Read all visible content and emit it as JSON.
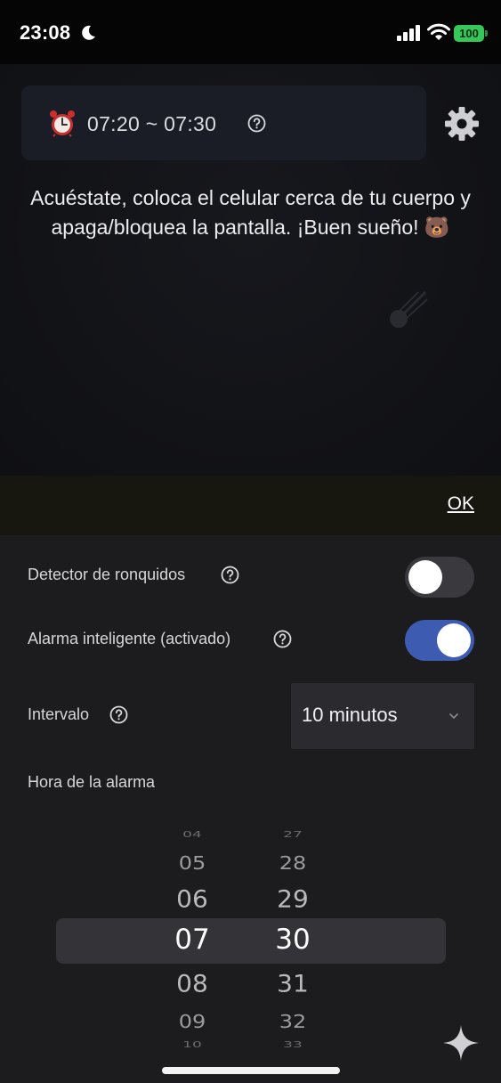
{
  "status_bar": {
    "time": "23:08",
    "battery": "100"
  },
  "alarm_card": {
    "range": "07:20 ~ 07:30"
  },
  "instruction": "Acuéstate, coloca el celular cerca de tu cuerpo y apaga/bloquea la pantalla. ¡Buen sueño! 🐻",
  "ok_label": "OK",
  "settings": {
    "snore_detector": {
      "label": "Detector de ronquidos",
      "enabled": false
    },
    "smart_alarm": {
      "label": "Alarma inteligente (activado)",
      "enabled": true
    },
    "interval": {
      "label": "Intervalo",
      "value": "10 minutos"
    },
    "alarm_time_label": "Hora de la alarma"
  },
  "picker": {
    "hours": [
      "04",
      "05",
      "06",
      "07",
      "08",
      "09",
      "10"
    ],
    "minutes": [
      "27",
      "28",
      "29",
      "30",
      "31",
      "32",
      "33"
    ],
    "selected_hour": "07",
    "selected_minute": "30"
  },
  "colors": {
    "accent_toggle": "#3d5bb0",
    "battery": "#35c759"
  }
}
